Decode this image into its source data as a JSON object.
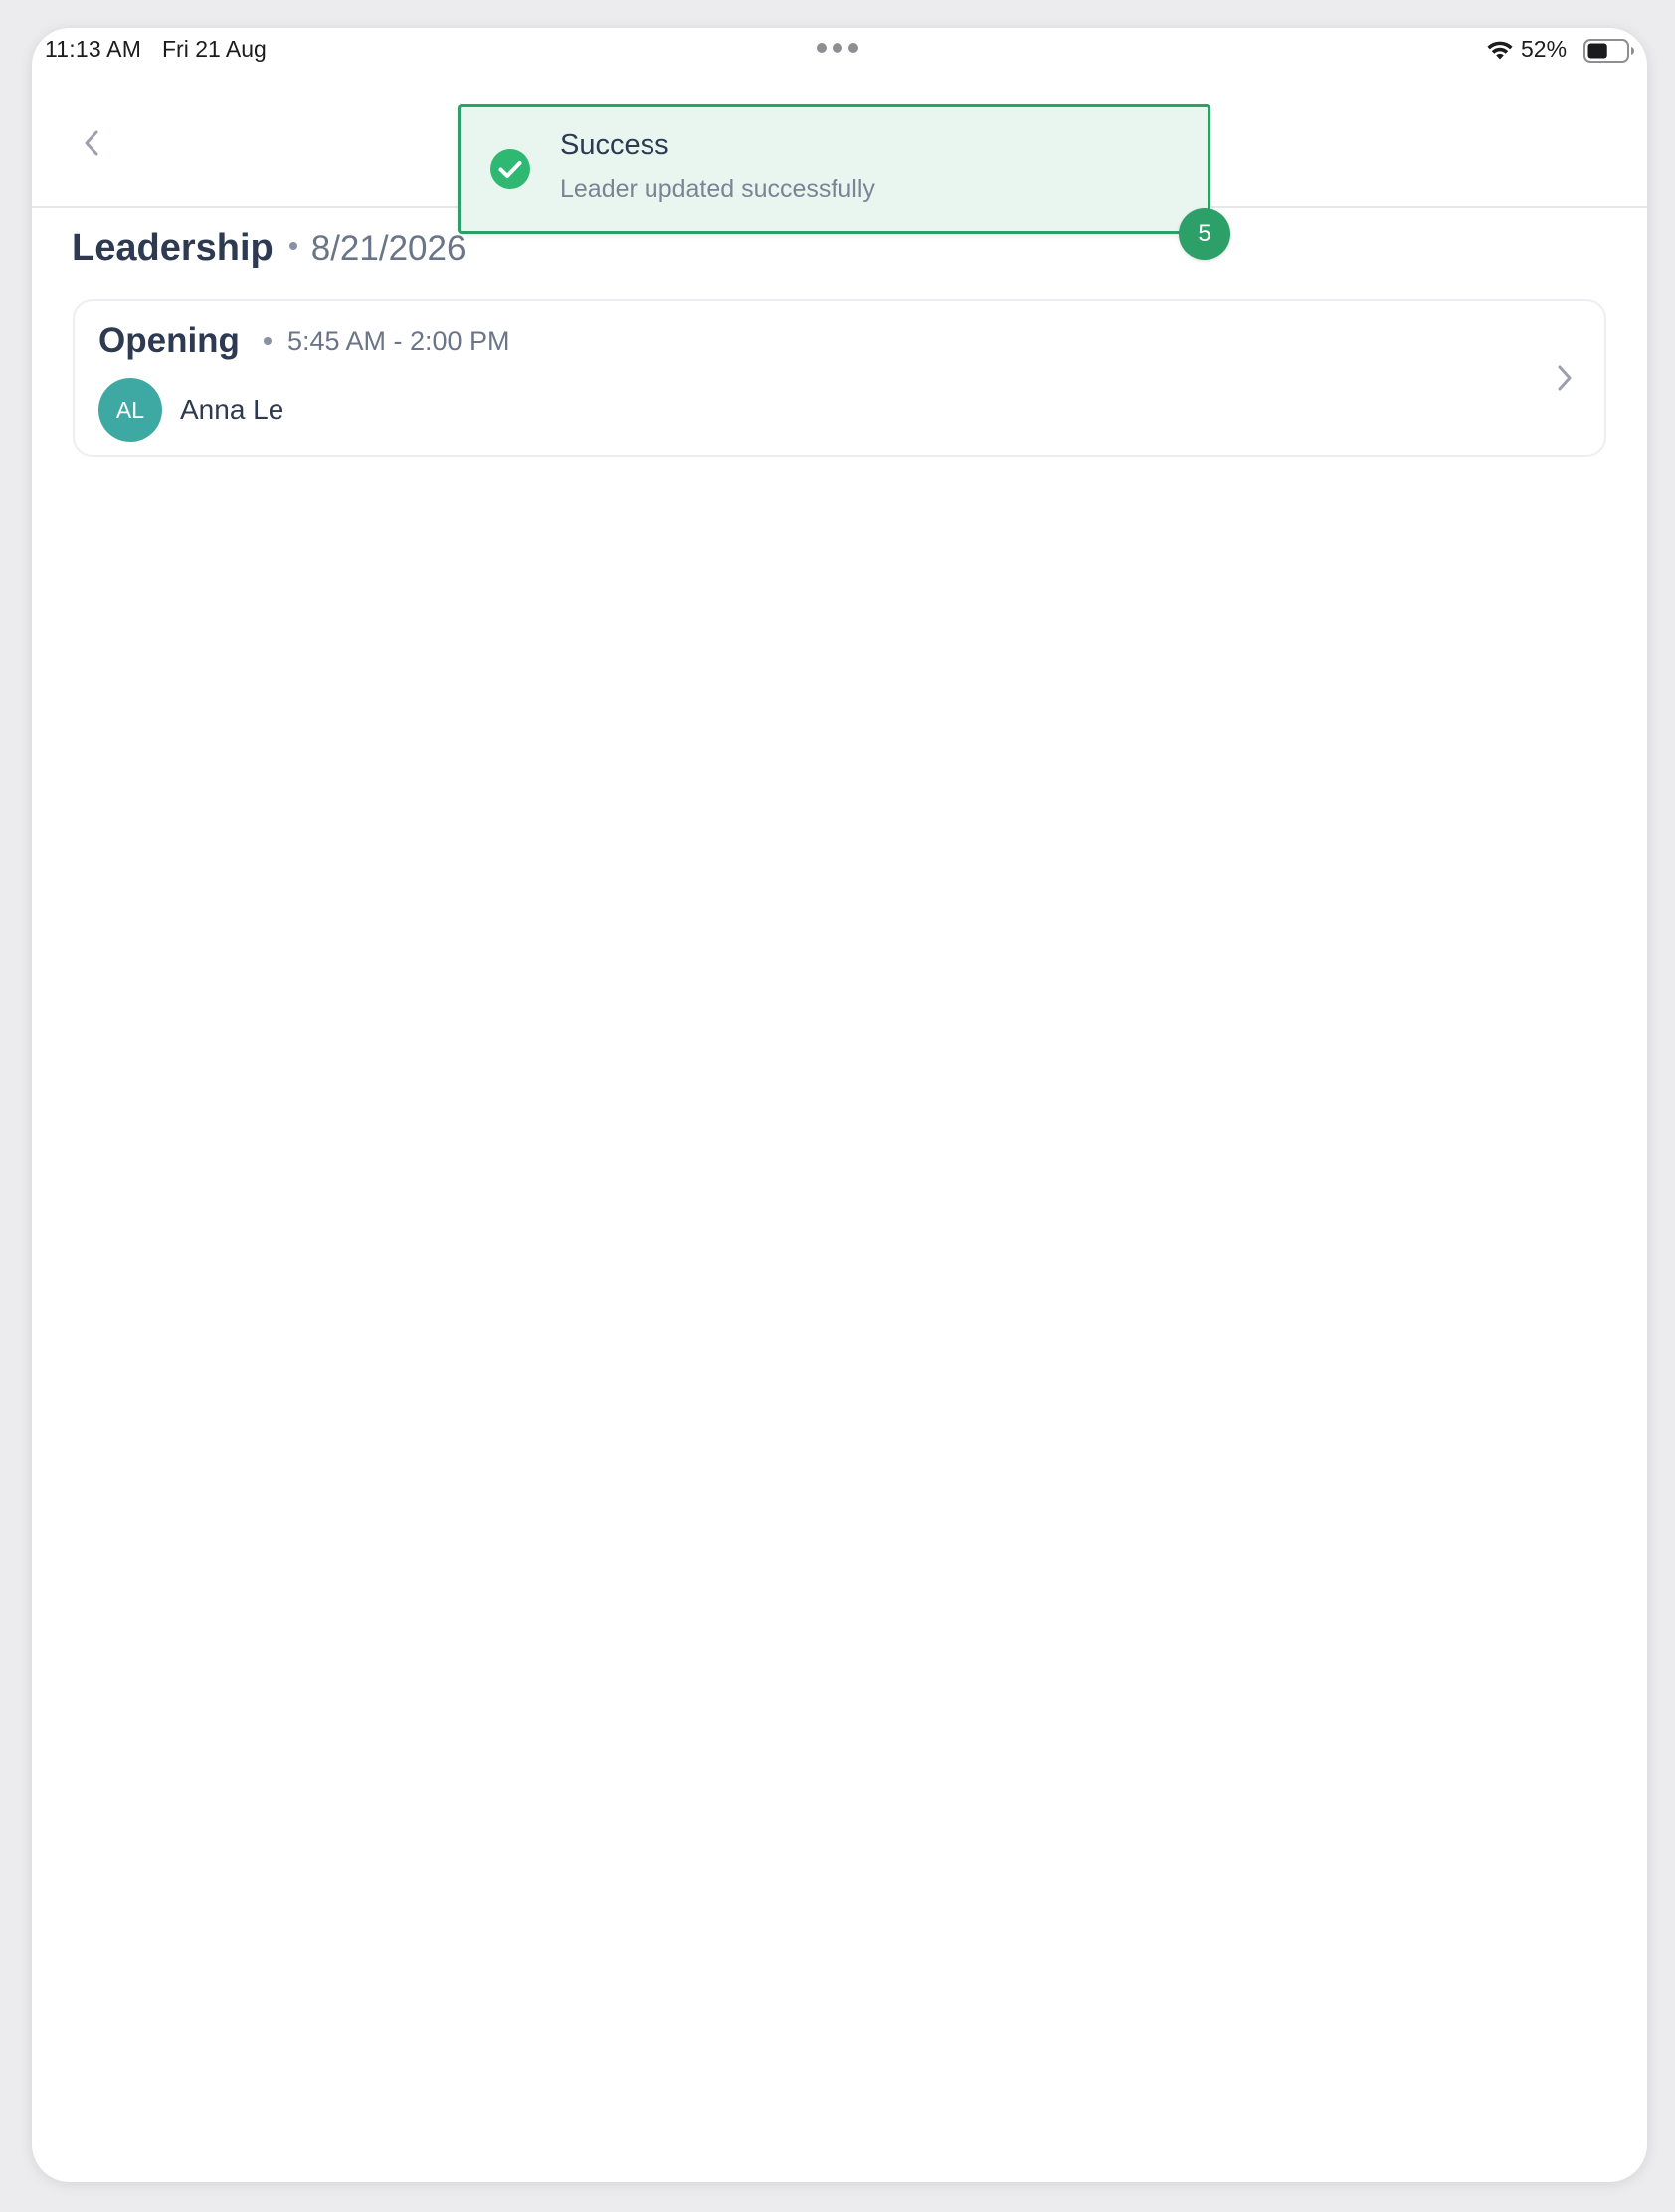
{
  "status_bar": {
    "time": "11:13 AM",
    "date": "Fri 21 Aug",
    "battery_percent": "52%",
    "battery_level": 0.52,
    "icons": [
      "wifi-icon",
      "battery-icon",
      "multitask-dots-icon"
    ]
  },
  "nav": {
    "back_icon": "chevron-left-icon"
  },
  "page": {
    "title": "Leadership",
    "date": "8/21/2026"
  },
  "shifts": [
    {
      "name": "Opening",
      "time": "5:45 AM - 2:00 PM",
      "assignee_initials": "AL",
      "assignee_name": "Anna Le",
      "chevron_icon": "chevron-right-icon"
    }
  ],
  "toast": {
    "title": "Success",
    "message": "Leader updated successfully",
    "count": "5",
    "icon": "check-circle-icon"
  },
  "colors": {
    "toast_border": "#2da06a",
    "toast_background": "#e8f6ef",
    "avatar": "#3ea8a3",
    "heading_text": "#2d3a52",
    "secondary_text": "#6b7588"
  }
}
